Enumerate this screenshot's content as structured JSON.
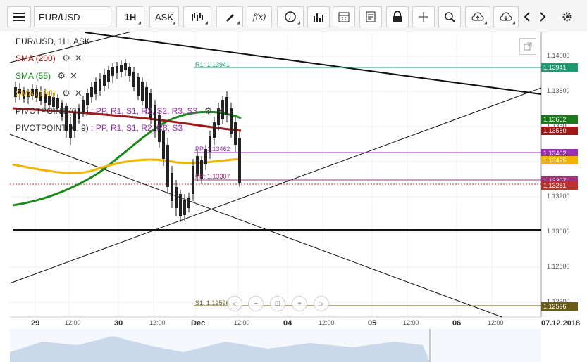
{
  "toolbar": {
    "menu_icon": "hamburger-icon",
    "symbol": "EUR/USD",
    "timeframe": "1H",
    "price_type": "ASK",
    "fx_label": "f(x)",
    "icons": [
      "bar-chart-style-icon",
      "draw-pencil-icon",
      "function-icon",
      "info-icon",
      "volume-bars-icon",
      "calendar-icon",
      "document-icon",
      "lock-icon",
      "crosshair-icon",
      "zoom-icon",
      "upload-cloud-icon",
      "download-cloud-icon",
      "chevron-left-icon",
      "chevron-right-icon",
      "gear-icon"
    ]
  },
  "legend": {
    "title": "EUR/USD, 1H, ASK",
    "sma200": "SMA (200)",
    "sma55": "SMA (55)",
    "sma100": "SMA (100)",
    "pivot1_name": "PIVOTPOINT (0, 8)",
    "pivot1_levels": ": PP, R1, S1, R2, S2, R3, S3",
    "pivot2_name": "PIVOTPOINT (0, 9)",
    "pivot2_levels": ": PP, R1, S1, R2, R3, S3"
  },
  "levels": {
    "r1": "R1: 1.13941",
    "pp1": "PP: 1.13462",
    "pp2": "PP: 1.13307",
    "s1": "S1: 1.12596"
  },
  "price_labels": [
    {
      "text": "1.13941",
      "color": "#1e9a72"
    },
    {
      "text": "1.13652",
      "color": "#1a7a1a"
    },
    {
      "text": "1.13580",
      "color": "#a01818"
    },
    {
      "text": "1.13462",
      "color": "#9b2fb4"
    },
    {
      "text": "1.13425",
      "color": "#f0b400"
    },
    {
      "text": "1.13307",
      "color": "#a0327e"
    },
    {
      "text": "1.13281",
      "color": "#c03030"
    },
    {
      "text": "1.12596",
      "color": "#6b5a1a"
    }
  ],
  "y_axis_ticks": [
    "1.14000",
    "1.13800",
    "1.13600",
    "1.13400",
    "1.13200",
    "1.13000",
    "1.12800",
    "1.12600"
  ],
  "x_axis": {
    "labels": [
      "29",
      "12:00",
      "30",
      "12:00",
      "Dec",
      "12:00",
      "04",
      "12:00",
      "05",
      "12:00",
      "06",
      "12:00",
      "07.12.2018"
    ]
  },
  "chart_data": {
    "type": "line",
    "title": "EUR/USD, 1H, ASK",
    "ylim": [
      1.1245,
      1.1415
    ],
    "series": [
      {
        "name": "SMA (200)",
        "values": [
          1.1368,
          1.1366,
          1.1364,
          1.1362,
          1.136,
          1.1359,
          1.1358
        ]
      },
      {
        "name": "SMA (55)",
        "values": [
          1.1309,
          1.1318,
          1.1333,
          1.135,
          1.1362,
          1.1368,
          1.1365
        ]
      },
      {
        "name": "SMA (100)",
        "values": [
          1.1343,
          1.1339,
          1.1335,
          1.1338,
          1.1343,
          1.1342,
          1.1342
        ]
      }
    ],
    "horizontal_levels": {
      "R1": 1.13941,
      "PP_0_8": 1.13462,
      "PP_0_9": 1.13307,
      "S1": 1.12596
    },
    "grid": true
  }
}
